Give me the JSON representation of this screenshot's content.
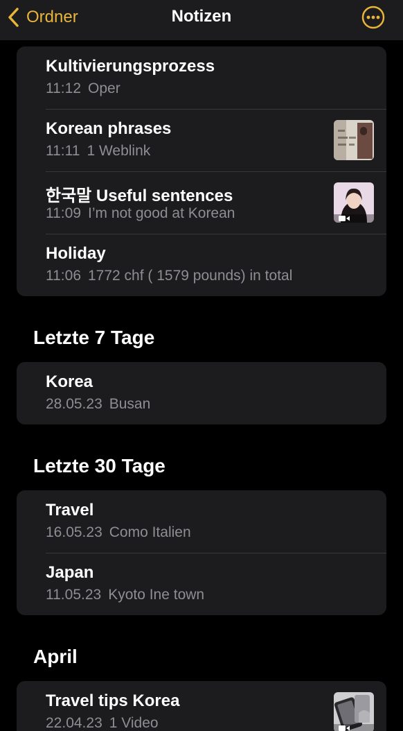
{
  "nav": {
    "back_label": "Ordner",
    "title": "Notizen",
    "back_icon": "chevron-left-icon",
    "more_icon": "ellipsis-circle-icon",
    "accent_color": "#e8b53a"
  },
  "group_today": {
    "notes": [
      {
        "title": "Kultivierungsprozess",
        "time": "11:12",
        "snippet": "Oper"
      },
      {
        "title": "Korean phrases",
        "time": "11:11",
        "snippet": "1 Weblink",
        "thumbnail": "web-page-thumbnail"
      },
      {
        "title": "한국말 Useful sentences",
        "time": "11:09",
        "snippet": "I’m not good at Korean",
        "thumbnail": "video-thumbnail"
      },
      {
        "title": "Holiday",
        "time": "11:06",
        "snippet": "1772 chf ( 1579 pounds) in total"
      }
    ]
  },
  "group_7_days": {
    "header": "Letzte 7 Tage",
    "notes": [
      {
        "title": "Korea",
        "time": "28.05.23",
        "snippet": "Busan"
      }
    ]
  },
  "group_30_days": {
    "header": "Letzte 30 Tage",
    "notes": [
      {
        "title": "Travel",
        "time": "16.05.23",
        "snippet": "Como Italien"
      },
      {
        "title": "Japan",
        "time": "11.05.23",
        "snippet": "Kyoto Ine town"
      }
    ]
  },
  "group_april": {
    "header": "April",
    "notes": [
      {
        "title": "Travel tips Korea",
        "time": "22.04.23",
        "snippet": "1 Video",
        "thumbnail": "video-thumbnail"
      }
    ]
  }
}
